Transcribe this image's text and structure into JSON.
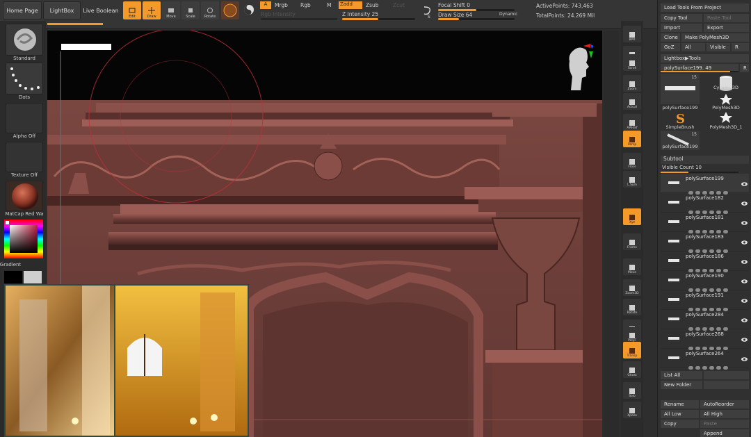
{
  "topbar": {
    "home_page": "Home Page",
    "lightbox": "LightBox",
    "live_boolean": "Live Boolean",
    "tools": [
      {
        "label": "Edit"
      },
      {
        "label": "Draw"
      },
      {
        "label": "Move"
      },
      {
        "label": "Scale"
      },
      {
        "label": "Rotate"
      }
    ],
    "modes": {
      "a": "A",
      "mrgb": "Mrgb",
      "rgb": "Rgb",
      "m": "M",
      "zadd": "Zadd",
      "zsub": "Zsub",
      "zcut": "Zcut"
    },
    "rgb_intensity": "Rgb Intensity",
    "z_intensity": "Z Intensity 25",
    "focal_shift": "Focal Shift 0",
    "draw_size": "Draw Size 64",
    "dynamic": "Dynamic",
    "active_points": "ActivePoints: 743,463",
    "total_points": "TotalPoints: 24.269 Mil",
    "colors": {
      "accent": "#f39a2b",
      "bar": "#353535"
    }
  },
  "left": {
    "brush": "Standard",
    "stroke": "Dots",
    "alpha": "Alpha Off",
    "texture": "Texture Off",
    "material": "MatCap Red Wa",
    "gradient": "Gradient"
  },
  "rstrip": [
    {
      "label": "BPR"
    },
    {
      "label": "SPix 3"
    },
    {
      "label": "Scroll"
    },
    {
      "label": "Zoom"
    },
    {
      "label": "Actual"
    },
    {
      "label": "AAHalf"
    },
    {
      "label": "Persp"
    },
    {
      "label": "Floor"
    },
    {
      "label": "L.Sym"
    },
    {
      "label": "Xyz"
    },
    {
      "label": "Frame"
    },
    {
      "label": "Move"
    },
    {
      "label": "Zoom3D"
    },
    {
      "label": "Rotate"
    },
    {
      "label": "Line Fill"
    },
    {
      "label": "PolyF"
    },
    {
      "label": "Transp"
    },
    {
      "label": "Ghost"
    },
    {
      "label": "Solo"
    },
    {
      "label": "Xpose"
    }
  ],
  "tray": {
    "load_tools": "Load Tools From Project",
    "copy_tool": "Copy Tool",
    "paste_tool": "Paste Tool",
    "import": "Import",
    "export": "Export",
    "clone": "Clone",
    "make_polymesh": "Make PolyMesh3D",
    "goz": "GoZ",
    "all": "All",
    "visible": "Visible",
    "r": "R",
    "lightbox_tools": "Lightbox▶Tools",
    "current_tool": "polySurface199. 49",
    "r2": "R",
    "tool_thumbs": [
      {
        "name": "polySurface199",
        "count": "15"
      },
      {
        "name": "Cylinder3D"
      },
      {
        "name": "polySurface199"
      },
      {
        "name": "PolyMesh3D"
      },
      {
        "name": "SimpleBrush"
      },
      {
        "name": "PolyMesh3D_1"
      },
      {
        "name": "polySurface199",
        "count": "15"
      }
    ],
    "subtool": "Subtool",
    "visible_count": "Visible Count 10",
    "subtools": [
      "polySurface199",
      "polySurface182",
      "polySurface181",
      "polySurface183",
      "polySurface186",
      "polySurface190",
      "polySurface191",
      "polySurface284",
      "polySurface268",
      "polySurface264"
    ],
    "list_all": "List All",
    "new_folder": "New Folder",
    "rename": "Rename",
    "autoreorder": "AutoReorder",
    "all_low": "All Low",
    "all_high": "All High",
    "copy": "Copy",
    "paste": "Paste",
    "append": "Append"
  }
}
